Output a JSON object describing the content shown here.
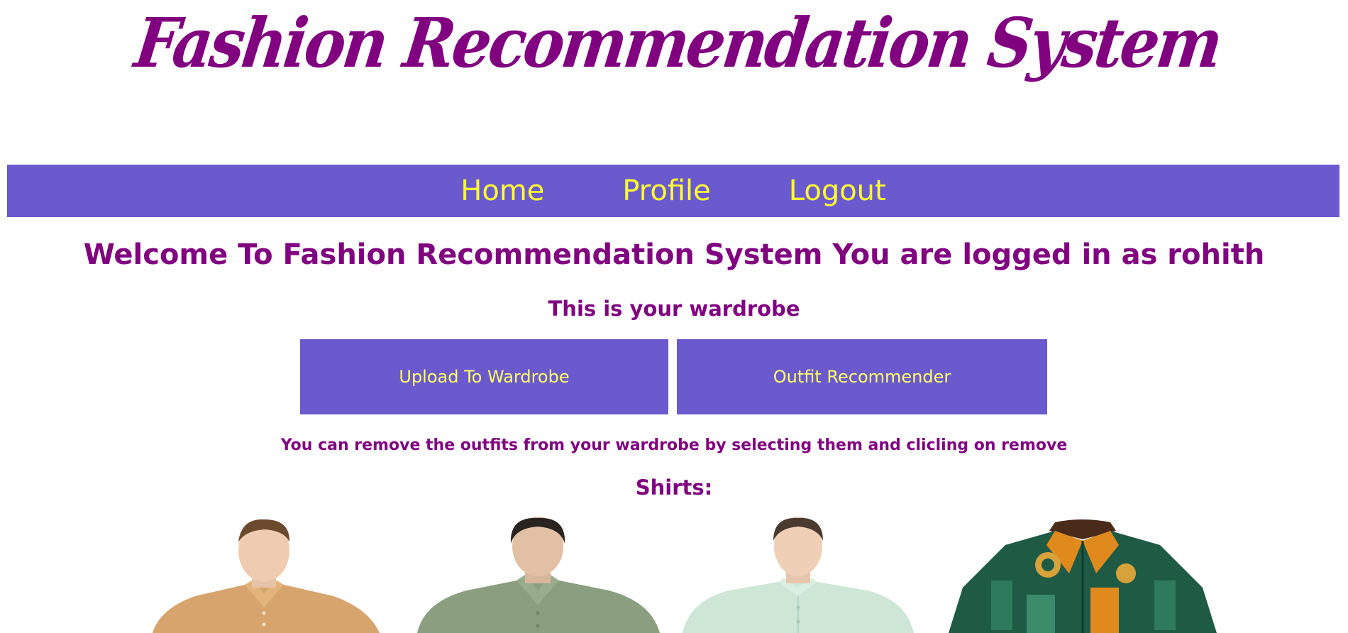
{
  "header": {
    "logo_text": "Fashion Recommendation System"
  },
  "nav": {
    "items": [
      {
        "label": "Home"
      },
      {
        "label": "Profile"
      },
      {
        "label": "Logout"
      }
    ]
  },
  "main": {
    "welcome": "Welcome To Fashion Recommendation System You are logged in as rohith",
    "wardrobe_title": "This is your wardrobe",
    "buttons": {
      "upload": "Upload To Wardrobe",
      "recommender": "Outfit Recommender"
    },
    "hint": "You can remove the outfits from your wardrobe by selecting them and clicling on remove",
    "shirts_title": "Shirts:"
  },
  "colors": {
    "accent": "#6a5acd",
    "brand": "#800080",
    "nav_text": "#ffff33"
  },
  "shirts": [
    {
      "icon": "shirt-photo-tan"
    },
    {
      "icon": "shirt-photo-olive"
    },
    {
      "icon": "shirt-photo-mint"
    },
    {
      "icon": "shirt-photo-pattern"
    }
  ]
}
